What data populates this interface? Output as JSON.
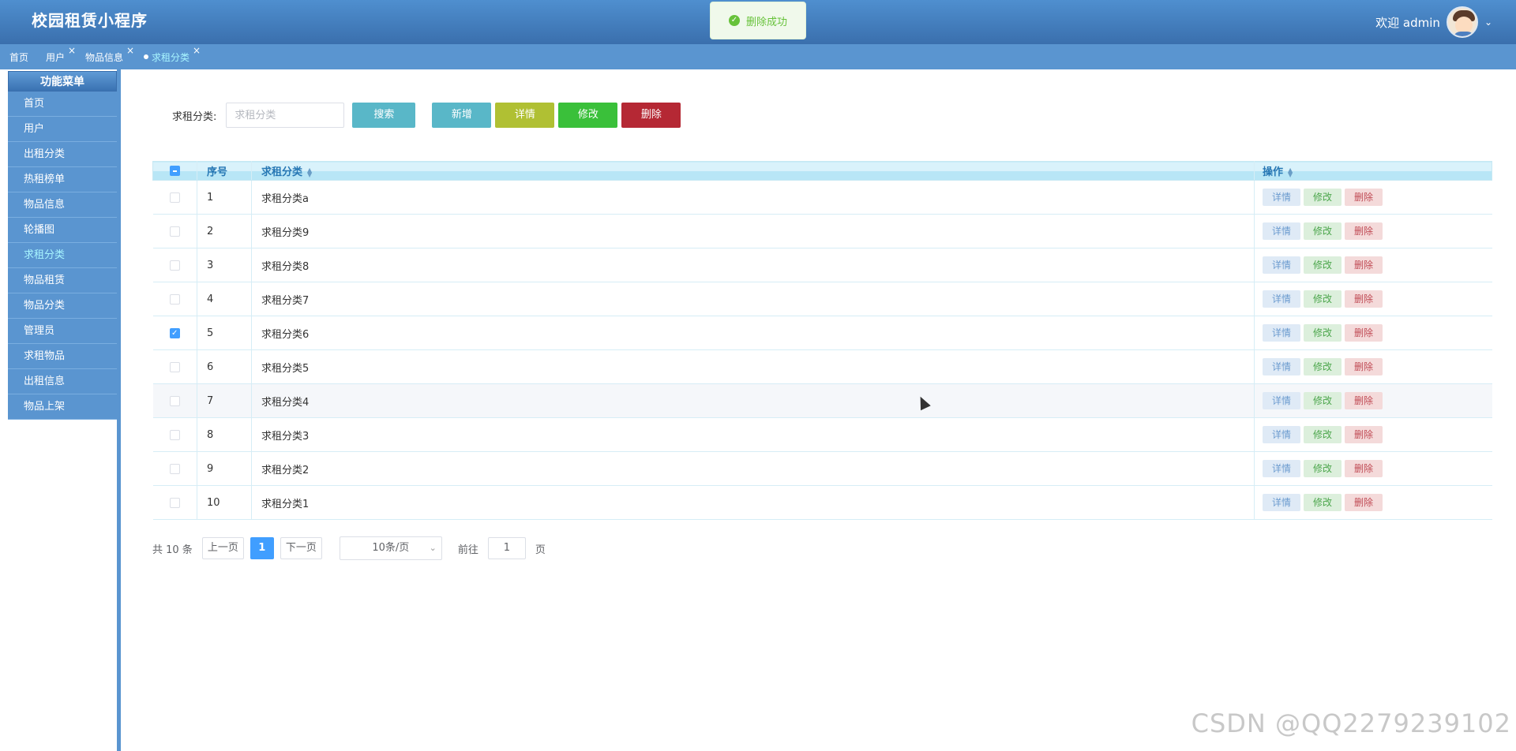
{
  "header": {
    "app_title": "校园租赁小程序",
    "welcome": "欢迎 admin"
  },
  "toast": {
    "message": "删除成功"
  },
  "tabs": [
    {
      "label": "首页"
    },
    {
      "label": "用户"
    },
    {
      "label": "物品信息"
    },
    {
      "label": "求租分类",
      "active": true
    }
  ],
  "sidebar": {
    "title": "功能菜单",
    "items": [
      {
        "label": "首页"
      },
      {
        "label": "用户"
      },
      {
        "label": "出租分类"
      },
      {
        "label": "热租榜单"
      },
      {
        "label": "物品信息"
      },
      {
        "label": "轮播图"
      },
      {
        "label": "求租分类",
        "active": true
      },
      {
        "label": "物品租赁"
      },
      {
        "label": "物品分类"
      },
      {
        "label": "管理员"
      },
      {
        "label": "求租物品"
      },
      {
        "label": "出租信息"
      },
      {
        "label": "物品上架"
      }
    ]
  },
  "search": {
    "label": "求租分类:",
    "placeholder": "求租分类",
    "search_button": "搜索",
    "add_button": "新增",
    "detail_button": "详情",
    "edit_button": "修改",
    "delete_button": "删除"
  },
  "table": {
    "headers": {
      "no": "序号",
      "name": "求租分类",
      "op": "操作"
    },
    "op_labels": {
      "detail": "详情",
      "edit": "修改",
      "delete": "删除"
    },
    "rows": [
      {
        "no": "1",
        "name": "求租分类a",
        "checked": false
      },
      {
        "no": "2",
        "name": "求租分类9",
        "checked": false
      },
      {
        "no": "3",
        "name": "求租分类8",
        "checked": false
      },
      {
        "no": "4",
        "name": "求租分类7",
        "checked": false
      },
      {
        "no": "5",
        "name": "求租分类6",
        "checked": true
      },
      {
        "no": "6",
        "name": "求租分类5",
        "checked": false
      },
      {
        "no": "7",
        "name": "求租分类4",
        "checked": false
      },
      {
        "no": "8",
        "name": "求租分类3",
        "checked": false
      },
      {
        "no": "9",
        "name": "求租分类2",
        "checked": false
      },
      {
        "no": "10",
        "name": "求租分类1",
        "checked": false
      }
    ]
  },
  "pager": {
    "total": "共 10 条",
    "prev": "上一页",
    "current": "1",
    "next": "下一页",
    "page_size": "10条/页",
    "goto": "前往",
    "goto_value": "1",
    "page_unit": "页"
  },
  "watermark": "CSDN @QQ2279239102",
  "colors": {
    "header": "#3a6fad",
    "tab_bar": "#5a95d0",
    "accent": "#409eff",
    "success": "#67c23a",
    "danger": "#b52834"
  },
  "icons": {
    "toast": "check-circle-icon",
    "user_dropdown": "chevron-down-icon",
    "tab_close": "close-icon",
    "sort": "sort-icon"
  }
}
